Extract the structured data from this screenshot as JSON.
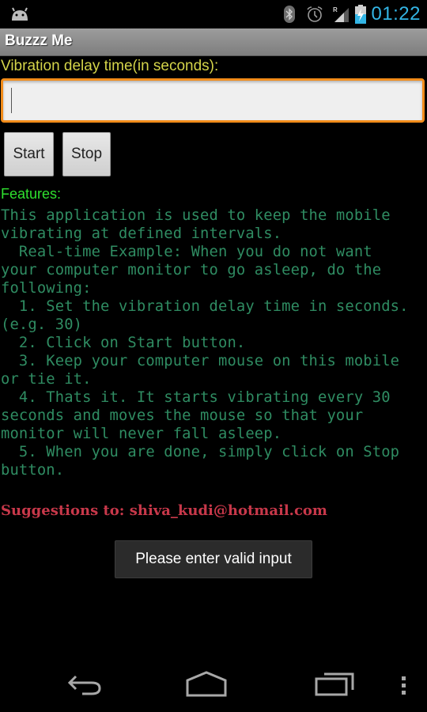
{
  "status_bar": {
    "time": "01:22",
    "icons": [
      "android-notification-icon",
      "bluetooth-icon",
      "alarm-icon",
      "signal-roaming-icon",
      "battery-charging-icon"
    ],
    "signal_label": "R",
    "clock_color": "#33b5e5"
  },
  "app": {
    "title": "Buzzz Me"
  },
  "form": {
    "delay_label": "Vibration delay time(in seconds):",
    "delay_value": "",
    "delay_placeholder": "",
    "start_label": "Start",
    "stop_label": "Stop",
    "focus_color": "#f28c1a"
  },
  "features": {
    "heading": "Features:",
    "body": "This application is used to keep the mobile\nvibrating at defined intervals.\n  Real-time Example: When you do not want\nyour computer monitor to go asleep, do the\nfollowing:\n  1. Set the vibration delay time in seconds.\n(e.g. 30)\n  2. Click on Start button.\n  3. Keep your computer mouse on this mobile\nor tie it.\n  4. Thats it. It starts vibrating every 30\nseconds and moves the mouse so that your\nmonitor will never fall asleep.\n  5. When you are done, simply click on Stop\nbutton.",
    "heading_color": "#2fe02f",
    "body_color": "#2f8c62"
  },
  "suggestions": {
    "text": "Suggestions to: shiva_kudi@hotmail.com",
    "color": "#c8384a"
  },
  "toast": {
    "message": "Please enter valid input"
  },
  "nav_bar": {
    "buttons": [
      "back-icon",
      "home-icon",
      "recent-apps-icon",
      "overflow-menu-icon"
    ]
  }
}
